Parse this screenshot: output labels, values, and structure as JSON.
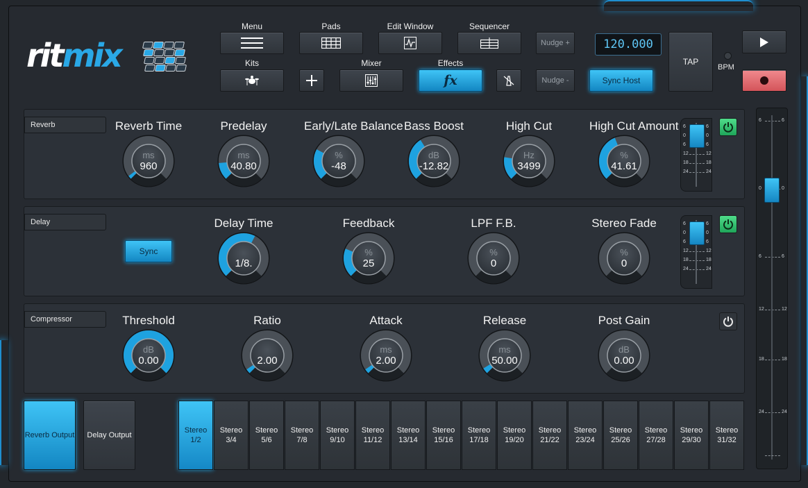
{
  "logo": {
    "part1": "rit",
    "part2": "mix"
  },
  "toolbar": {
    "menu": "Menu",
    "pads": "Pads",
    "edit_window": "Edit Window",
    "sequencer": "Sequencer",
    "kits": "Kits",
    "mixer": "Mixer",
    "effects": "Effects",
    "nudge_plus": "Nudge +",
    "nudge_minus": "Nudge -",
    "bpm_value": "120.000",
    "tap": "TAP",
    "bpm_label": "BPM",
    "sync_host": "Sync Host"
  },
  "reverb": {
    "title": "Reverb",
    "enabled": true,
    "knobs": [
      {
        "label": "Reverb Time",
        "unit": "ms",
        "value": "960",
        "level": 0.03
      },
      {
        "label": "Predelay",
        "unit": "ms",
        "value": "40.80",
        "level": 0.15
      },
      {
        "label": "Early/Late Balance",
        "unit": "%",
        "value": "-48",
        "level": 0.27
      },
      {
        "label": "Bass Boost",
        "unit": "dB",
        "value": "-12.82",
        "level": 0.38
      },
      {
        "label": "High Cut",
        "unit": "Hz",
        "value": "3499",
        "level": 0.2
      },
      {
        "label": "High Cut Amount",
        "unit": "%",
        "value": "41.61",
        "level": 0.42
      }
    ]
  },
  "delay": {
    "title": "Delay",
    "enabled": true,
    "sync_label": "Sync",
    "knobs": [
      {
        "label": "Delay Time",
        "unit": "",
        "value": "1/8.",
        "level": 0.6
      },
      {
        "label": "Feedback",
        "unit": "%",
        "value": "25",
        "level": 0.25
      },
      {
        "label": "LPF F.B.",
        "unit": "%",
        "value": "0",
        "level": 0
      },
      {
        "label": "Stereo Fade",
        "unit": "%",
        "value": "0",
        "level": 0
      }
    ]
  },
  "compressor": {
    "title": "Compressor",
    "enabled": false,
    "knobs": [
      {
        "label": "Threshold",
        "unit": "dB",
        "value": "0.00",
        "level": 1.0
      },
      {
        "label": "Ratio",
        "unit": "",
        "value": "2.00",
        "level": 0.04
      },
      {
        "label": "Attack",
        "unit": "ms",
        "value": "2.00",
        "level": 0.04
      },
      {
        "label": "Release",
        "unit": "ms",
        "value": "50.00",
        "level": 0.05
      },
      {
        "label": "Post Gain",
        "unit": "dB",
        "value": "0.00",
        "level": 0
      }
    ]
  },
  "meter_ticks": [
    "6",
    "0",
    "6",
    "12",
    "18",
    "24"
  ],
  "mini_meter_ticks": [
    "6",
    "0",
    "6",
    "12",
    "18",
    "24"
  ],
  "outputs": {
    "reverb": "Reverb Output",
    "delay": "Delay  Output"
  },
  "channels": [
    {
      "top": "Stereo",
      "bottom": "1/2"
    },
    {
      "top": "Stereo",
      "bottom": "3/4"
    },
    {
      "top": "Stereo",
      "bottom": "5/6"
    },
    {
      "top": "Stereo",
      "bottom": "7/8"
    },
    {
      "top": "Stereo",
      "bottom": "9/10"
    },
    {
      "top": "Stereo",
      "bottom": "11/12"
    },
    {
      "top": "Stereo",
      "bottom": "13/14"
    },
    {
      "top": "Stereo",
      "bottom": "15/16"
    },
    {
      "top": "Stereo",
      "bottom": "17/18"
    },
    {
      "top": "Stereo",
      "bottom": "19/20"
    },
    {
      "top": "Stereo",
      "bottom": "21/22"
    },
    {
      "top": "Stereo",
      "bottom": "23/24"
    },
    {
      "top": "Stereo",
      "bottom": "25/26"
    },
    {
      "top": "Stereo",
      "bottom": "27/28"
    },
    {
      "top": "Stereo",
      "bottom": "29/30"
    },
    {
      "top": "Stereo",
      "bottom": "31/32"
    }
  ],
  "selected_channel": 0,
  "colors": {
    "accent": "#1ea2e0",
    "power_on": "#2fc36e",
    "record": "#e0686e"
  }
}
